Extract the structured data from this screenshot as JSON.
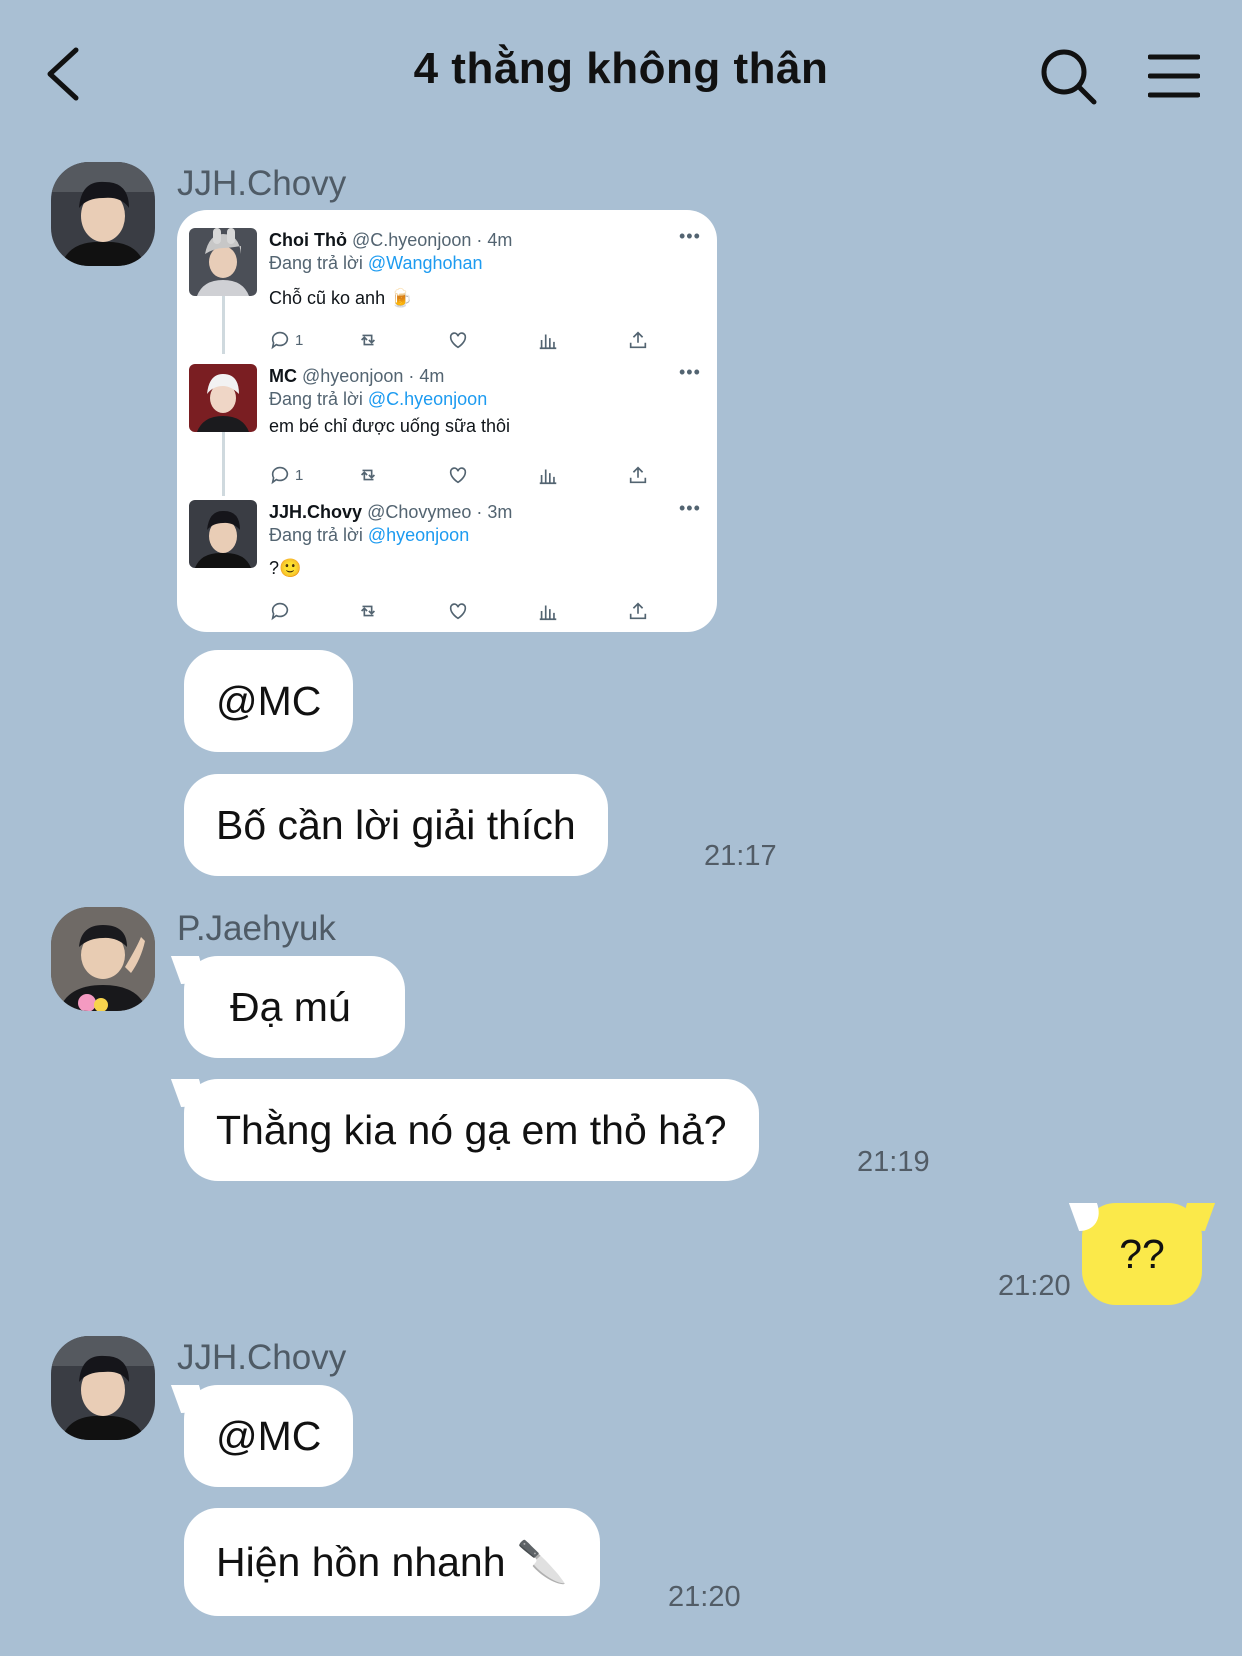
{
  "header": {
    "title": "4 thằng không thân",
    "back_icon": "chevron-left-icon",
    "search_icon": "search-icon",
    "menu_icon": "hamburger-menu-icon"
  },
  "colors": {
    "background": "#a9bfd3",
    "bubble_other": "#ffffff",
    "bubble_mine": "#fbe94a",
    "tweet_mention": "#1d9bf0"
  },
  "groups": [
    {
      "sender": "JJH.Chovy",
      "tweet_card": {
        "tweets": [
          {
            "name": "Choi Thỏ",
            "handle_time": "@C.hyeonjoon · 4m",
            "reply_prefix": "Đang trả lời",
            "reply_to": "@Wanghohan",
            "text": "Chỗ cũ ko anh 🍺",
            "reply_count": "1"
          },
          {
            "name": "MC",
            "handle_time": "@hyeonjoon · 4m",
            "reply_prefix": "Đang trả lời",
            "reply_to": "@C.hyeonjoon",
            "text": "em bé chỉ được uống sữa thôi",
            "reply_count": "1"
          },
          {
            "name": "JJH.Chovy",
            "handle_time": "@Chovymeo · 3m",
            "reply_prefix": "Đang trả lời",
            "reply_to": "@hyeonjoon",
            "text": "?🙂",
            "reply_count": ""
          }
        ],
        "more_label": "•••"
      },
      "messages": [
        {
          "text": "@MC"
        },
        {
          "text": "Bố cần lời giải thích",
          "time": "21:17"
        }
      ]
    },
    {
      "sender": "P.Jaehyuk",
      "messages": [
        {
          "text": "Đạ mú"
        },
        {
          "text": "Thằng kia nó gạ em thỏ hả?",
          "time": "21:19"
        }
      ]
    },
    {
      "sender": "me",
      "messages": [
        {
          "text": "??",
          "time": "21:20"
        }
      ]
    },
    {
      "sender": "JJH.Chovy",
      "messages": [
        {
          "text": "@MC"
        },
        {
          "text": "Hiện hồn nhanh 🔪",
          "time": "21:20"
        }
      ]
    }
  ]
}
